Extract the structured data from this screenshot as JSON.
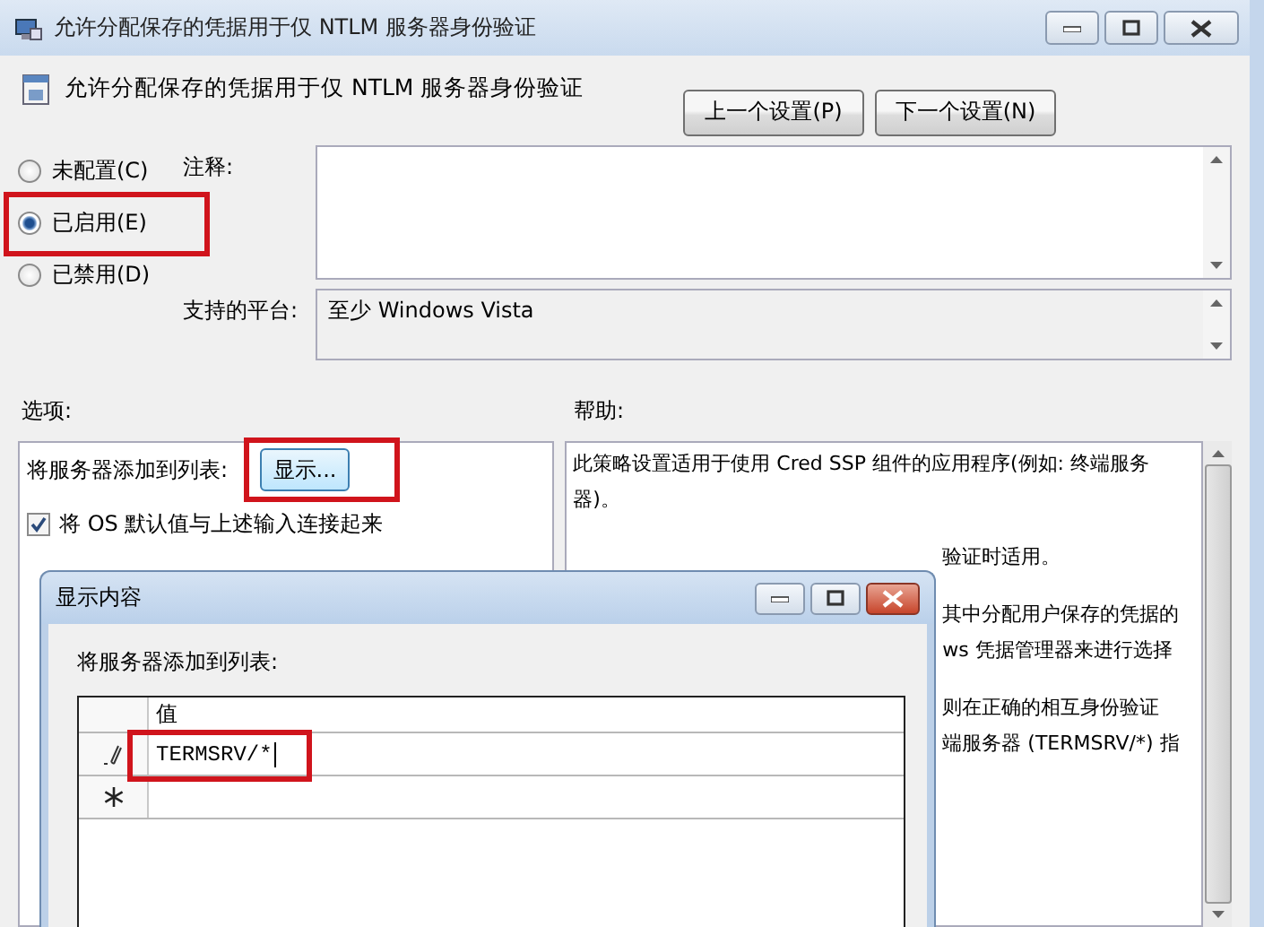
{
  "window": {
    "title": "允许分配保存的凭据用于仅 NTLM 服务器身份验证"
  },
  "header": {
    "title": "允许分配保存的凭据用于仅 NTLM 服务器身份验证",
    "buttons": [
      "上一个设置(P)",
      "下一个设置(N)"
    ]
  },
  "state_options": [
    {
      "label": "未配置(C)",
      "selected": false,
      "highlighted": false
    },
    {
      "label": "已启用(E)",
      "selected": true,
      "highlighted": true
    },
    {
      "label": "已禁用(D)",
      "selected": false,
      "highlighted": false
    }
  ],
  "comment": {
    "label": "注释:"
  },
  "platform": {
    "label": "支持的平台:",
    "value": "至少 Windows Vista"
  },
  "options": {
    "label": "选项:",
    "list_label": "将服务器添加到列表:",
    "show_button": {
      "label": "显示...",
      "highlighted": true
    },
    "concat": {
      "label": "将 OS 默认值与上述输入连接起来",
      "checked": true
    }
  },
  "help": {
    "label": "帮助:",
    "paragraphs": [
      {
        "kind": "full",
        "lines": [
          "此策略设置适用于使用 Cred SSP 组件的应用程序(例如: 终端服务",
          "器)。"
        ]
      },
      {
        "kind": "tail",
        "lines": [
          "验证时适用。"
        ]
      },
      {
        "kind": "tail",
        "lines": [
          "其中分配用户保存的凭据的",
          "ws 凭据管理器来进行选择"
        ]
      },
      {
        "kind": "tail",
        "lines": [
          "则在正确的相互身份验证",
          "端服务器 (TERMSRV/*) 指"
        ]
      }
    ]
  },
  "dialog": {
    "title": "显示内容",
    "list_label": "将服务器添加到列表:",
    "column": "值",
    "rows": [
      {
        "kind": "editing",
        "value": "TERMSRV/*",
        "highlighted": true
      },
      {
        "kind": "new",
        "value": "",
        "highlighted": false
      }
    ]
  }
}
